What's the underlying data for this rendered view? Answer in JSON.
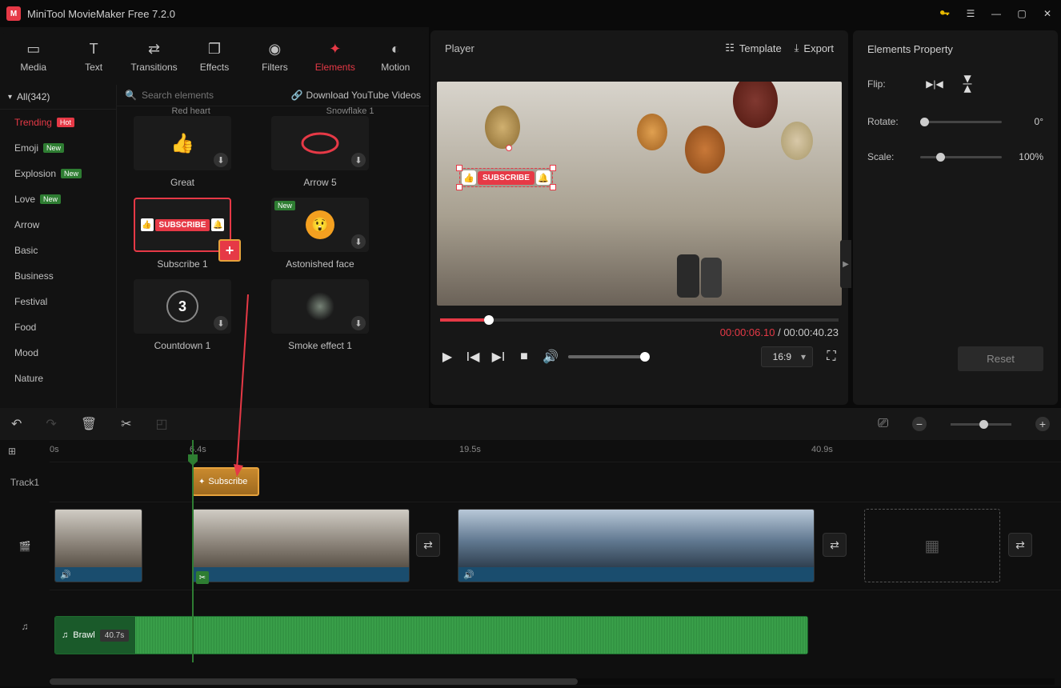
{
  "app_title": "MiniTool MovieMaker Free 7.2.0",
  "top_tabs": [
    {
      "label": "Media",
      "icon": "folder"
    },
    {
      "label": "Text",
      "icon": "text"
    },
    {
      "label": "Transitions",
      "icon": "swap"
    },
    {
      "label": "Effects",
      "icon": "stack"
    },
    {
      "label": "Filters",
      "icon": "circles"
    },
    {
      "label": "Elements",
      "icon": "star",
      "active": true
    },
    {
      "label": "Motion",
      "icon": "motion"
    }
  ],
  "categories_header": "All(342)",
  "categories": [
    {
      "label": "Trending",
      "badge": "Hot",
      "active": true
    },
    {
      "label": "Emoji",
      "badge": "New"
    },
    {
      "label": "Explosion",
      "badge": "New"
    },
    {
      "label": "Love",
      "badge": "New"
    },
    {
      "label": "Arrow"
    },
    {
      "label": "Basic"
    },
    {
      "label": "Business"
    },
    {
      "label": "Festival"
    },
    {
      "label": "Food"
    },
    {
      "label": "Mood"
    },
    {
      "label": "Nature"
    }
  ],
  "search_placeholder": "Search elements",
  "youtube_link": "Download YouTube Videos",
  "elements_cut_top": [
    "Red heart",
    "Snowflake 1"
  ],
  "elements": [
    [
      {
        "label": "Great"
      },
      {
        "label": "Arrow 5"
      }
    ],
    [
      {
        "label": "Subscribe 1",
        "selected": true,
        "subscribe": true
      },
      {
        "label": "Astonished face",
        "new": true
      }
    ],
    [
      {
        "label": "Countdown 1",
        "countdown": true
      },
      {
        "label": "Smoke effect 1",
        "smoke": true
      }
    ]
  ],
  "player": {
    "label": "Player",
    "template_btn": "Template",
    "export_btn": "Export",
    "subscribe_overlay": "SUBSCRIBE",
    "time_current": "00:00:06.10",
    "time_sep": " / ",
    "time_total": "00:00:40.23",
    "ratio": "16:9"
  },
  "props": {
    "title": "Elements Property",
    "flip_label": "Flip:",
    "rotate_label": "Rotate:",
    "rotate_value": "0°",
    "scale_label": "Scale:",
    "scale_value": "100%",
    "reset": "Reset"
  },
  "timeline": {
    "ruler": [
      {
        "label": "0s",
        "pos": 0
      },
      {
        "label": "6.4s",
        "pos": 175
      },
      {
        "label": "19.5s",
        "pos": 512
      },
      {
        "label": "40.9s",
        "pos": 952
      }
    ],
    "track_label": "Track1",
    "element_clip": "Subscribe",
    "audio_name": "Brawl",
    "audio_duration": "40.7s"
  }
}
